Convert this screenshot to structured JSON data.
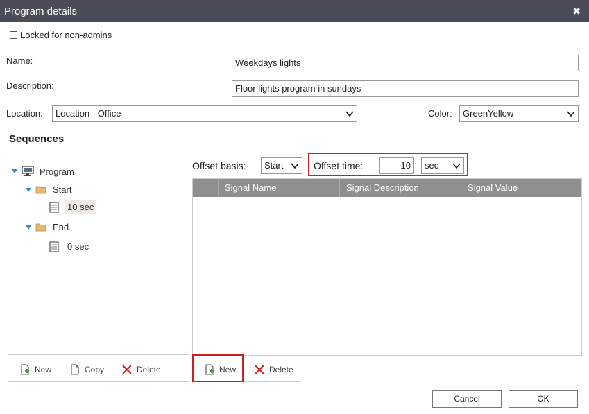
{
  "dialog": {
    "title": "Program details",
    "close_glyph": "✖"
  },
  "locked": {
    "label": "Locked for non-admins",
    "checked": false
  },
  "form": {
    "name_label": "Name:",
    "name_value": "Weekdays lights",
    "description_label": "Description:",
    "description_value": "Floor lights program in sundays",
    "location_label": "Location:",
    "location_value": "Location - Office",
    "color_label": "Color:",
    "color_value": "GreenYellow"
  },
  "sequences": {
    "title": "Sequences",
    "tree": {
      "root": "Program",
      "start": "Start",
      "start_child": "10 sec",
      "end": "End",
      "end_child": "0 sec"
    },
    "toolbar": {
      "new": "New",
      "copy": "Copy",
      "delete": "Delete"
    }
  },
  "offset": {
    "basis_label": "Offset basis:",
    "basis_value": "Start",
    "time_label": "Offset time:",
    "time_value": "10",
    "unit_value": "sec"
  },
  "signals": {
    "columns": [
      "Signal Name",
      "Signal Description",
      "Signal Value"
    ],
    "toolbar": {
      "new": "New",
      "delete": "Delete"
    }
  },
  "footer": {
    "cancel": "Cancel",
    "ok": "OK"
  },
  "colors": {
    "titlebar": "#4a4d57",
    "grid_header": "#8f8f8f",
    "highlight": "#cc1f1f",
    "tree_arrow": "#3a88c6"
  }
}
